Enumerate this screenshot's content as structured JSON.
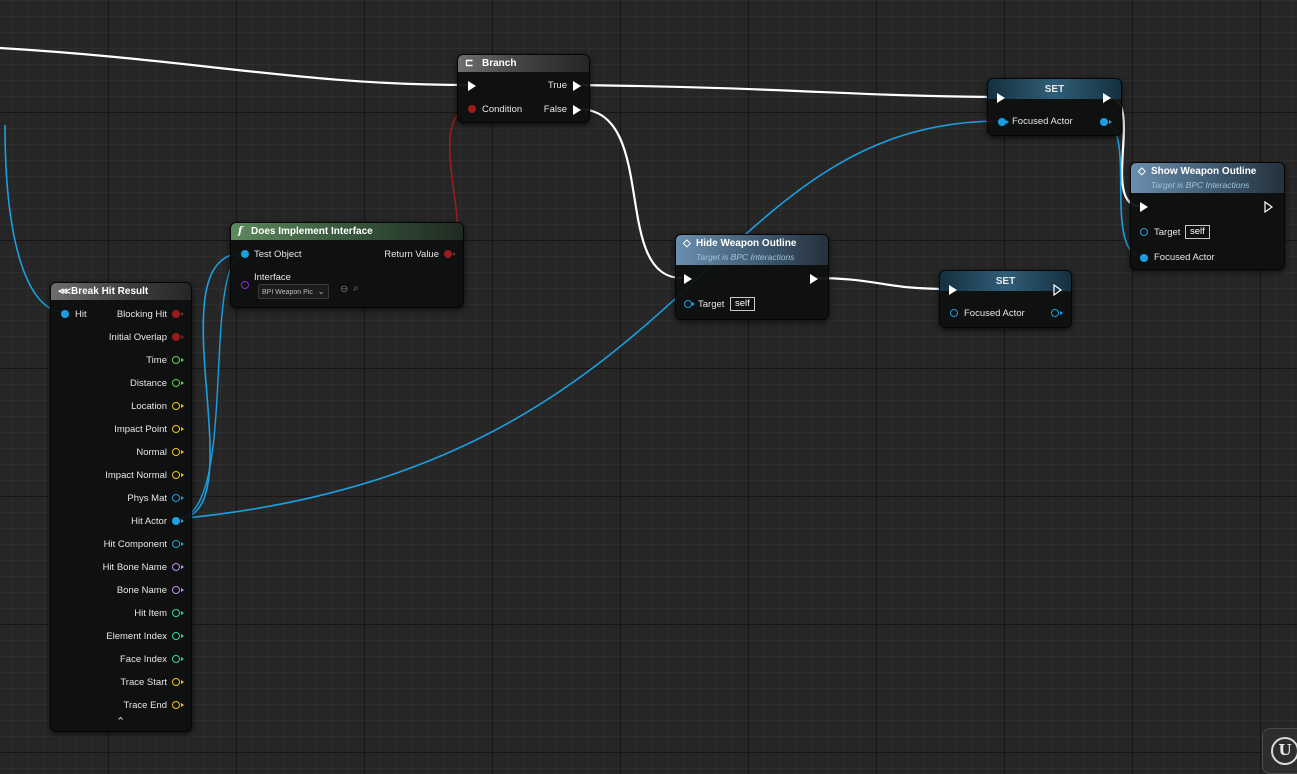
{
  "nodes": {
    "branch": {
      "title": "Branch",
      "true_label": "True",
      "false_label": "False",
      "condition_label": "Condition"
    },
    "does_implement": {
      "title": "Does Implement Interface",
      "test_object_label": "Test Object",
      "return_value_label": "Return Value",
      "interface_label": "Interface",
      "interface_value": "BPI Weapon Pic"
    },
    "break_hit_result": {
      "title": "Break Hit Result",
      "input_label": "Hit",
      "outputs": [
        {
          "label": "Blocking Hit",
          "color": "#9b1c1c"
        },
        {
          "label": "Initial Overlap",
          "color": "#9b1c1c"
        },
        {
          "label": "Time",
          "color": "#5ed34b"
        },
        {
          "label": "Distance",
          "color": "#5ed34b"
        },
        {
          "label": "Location",
          "color": "#f0c31c"
        },
        {
          "label": "Impact Point",
          "color": "#f0c31c"
        },
        {
          "label": "Normal",
          "color": "#f0c31c"
        },
        {
          "label": "Impact Normal",
          "color": "#f0c31c"
        },
        {
          "label": "Phys Mat",
          "color": "#1aa3e0"
        },
        {
          "label": "Hit Actor",
          "color": "#1aa3e0"
        },
        {
          "label": "Hit Component",
          "color": "#1aa3e0"
        },
        {
          "label": "Hit Bone Name",
          "color": "#c38ef0"
        },
        {
          "label": "Bone Name",
          "color": "#c38ef0"
        },
        {
          "label": "Hit Item",
          "color": "#2fd9a5"
        },
        {
          "label": "Element Index",
          "color": "#2fd9a5"
        },
        {
          "label": "Face Index",
          "color": "#2fd9a5"
        },
        {
          "label": "Trace Start",
          "color": "#f0c31c"
        },
        {
          "label": "Trace End",
          "color": "#f0c31c"
        }
      ],
      "collapse_glyph": "⌃"
    },
    "hide_weapon": {
      "title": "Hide Weapon Outline",
      "subtitle": "Target is BPC Interactions",
      "target_label": "Target",
      "target_value": "self"
    },
    "set_top": {
      "title": "SET",
      "pin_label": "Focused Actor"
    },
    "set_bottom": {
      "title": "SET",
      "pin_label": "Focused Actor"
    },
    "show_weapon": {
      "title": "Show Weapon Outline",
      "subtitle": "Target is BPC Interactions",
      "target_label": "Target",
      "target_value": "self",
      "focused_label": "Focused Actor"
    }
  },
  "colors": {
    "exec_wire": "#ffffff",
    "object_wire": "#1a9fe0",
    "bool_wire": "#9b1c1c",
    "interface_pin": "#8a2be2"
  },
  "icons": {
    "branch": "branch-icon",
    "function": "function-icon",
    "event": "diamond-icon",
    "break_struct": "break-struct-icon",
    "engine": "unreal-logo-icon"
  },
  "logo_glyph": "U",
  "function_glyph": "f"
}
